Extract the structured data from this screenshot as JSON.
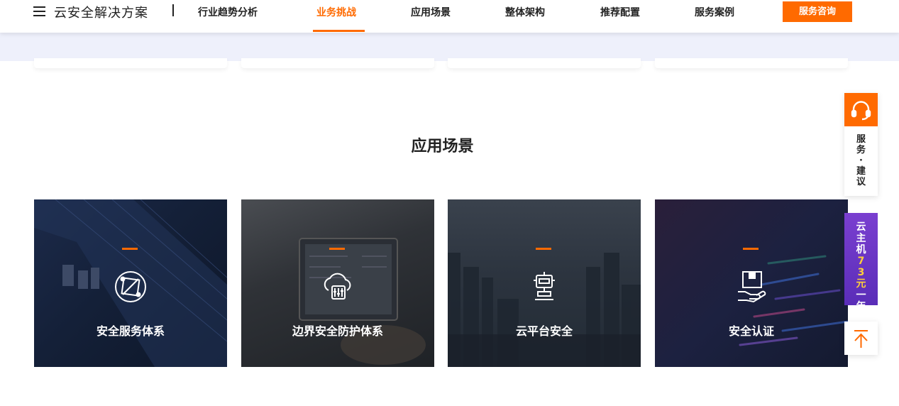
{
  "header": {
    "brand": "云安全解决方案",
    "nav": [
      {
        "label": "行业趋势分析",
        "active": false
      },
      {
        "label": "业务挑战",
        "active": true
      },
      {
        "label": "应用场景",
        "active": false
      },
      {
        "label": "整体架构",
        "active": false
      },
      {
        "label": "推荐配置",
        "active": false
      },
      {
        "label": "服务案例",
        "active": false
      }
    ],
    "consult_label": "服务咨询",
    "accent_color": "#ff6a00"
  },
  "section": {
    "title": "应用场景",
    "cards": [
      {
        "label": "安全服务体系",
        "icon": "target-scope-icon"
      },
      {
        "label": "边界安全防护体系",
        "icon": "cloud-firewall-icon"
      },
      {
        "label": "云平台安全",
        "icon": "robot-terminal-icon"
      },
      {
        "label": "安全认证",
        "icon": "hand-box-icon"
      }
    ]
  },
  "floating": {
    "service_label": "服务·建议",
    "promo": {
      "pre": "云主机",
      "price": "73元",
      "post": "一年"
    },
    "promo_color": "#6a35c4"
  }
}
